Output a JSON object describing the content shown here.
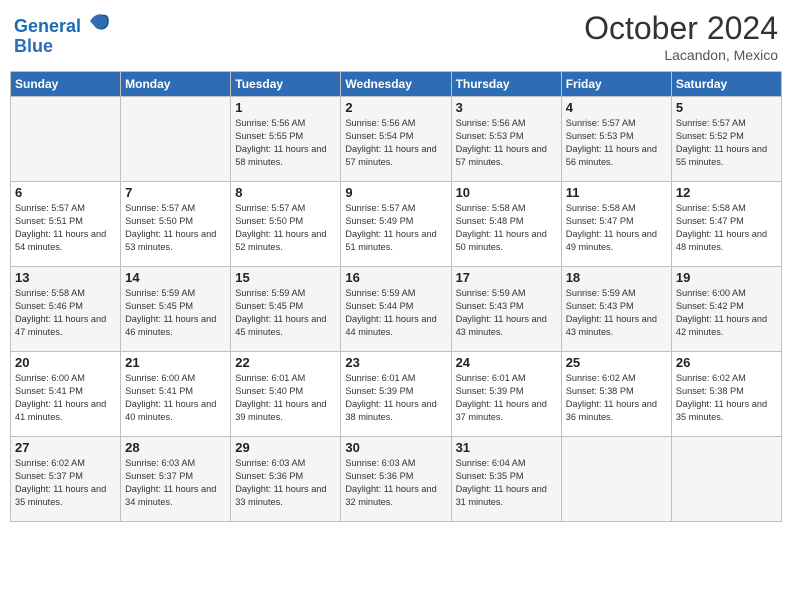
{
  "header": {
    "logo_line1": "General",
    "logo_line2": "Blue",
    "month": "October 2024",
    "location": "Lacandon, Mexico"
  },
  "weekdays": [
    "Sunday",
    "Monday",
    "Tuesday",
    "Wednesday",
    "Thursday",
    "Friday",
    "Saturday"
  ],
  "weeks": [
    [
      {
        "day": "",
        "info": ""
      },
      {
        "day": "",
        "info": ""
      },
      {
        "day": "1",
        "info": "Sunrise: 5:56 AM\nSunset: 5:55 PM\nDaylight: 11 hours and 58 minutes."
      },
      {
        "day": "2",
        "info": "Sunrise: 5:56 AM\nSunset: 5:54 PM\nDaylight: 11 hours and 57 minutes."
      },
      {
        "day": "3",
        "info": "Sunrise: 5:56 AM\nSunset: 5:53 PM\nDaylight: 11 hours and 57 minutes."
      },
      {
        "day": "4",
        "info": "Sunrise: 5:57 AM\nSunset: 5:53 PM\nDaylight: 11 hours and 56 minutes."
      },
      {
        "day": "5",
        "info": "Sunrise: 5:57 AM\nSunset: 5:52 PM\nDaylight: 11 hours and 55 minutes."
      }
    ],
    [
      {
        "day": "6",
        "info": "Sunrise: 5:57 AM\nSunset: 5:51 PM\nDaylight: 11 hours and 54 minutes."
      },
      {
        "day": "7",
        "info": "Sunrise: 5:57 AM\nSunset: 5:50 PM\nDaylight: 11 hours and 53 minutes."
      },
      {
        "day": "8",
        "info": "Sunrise: 5:57 AM\nSunset: 5:50 PM\nDaylight: 11 hours and 52 minutes."
      },
      {
        "day": "9",
        "info": "Sunrise: 5:57 AM\nSunset: 5:49 PM\nDaylight: 11 hours and 51 minutes."
      },
      {
        "day": "10",
        "info": "Sunrise: 5:58 AM\nSunset: 5:48 PM\nDaylight: 11 hours and 50 minutes."
      },
      {
        "day": "11",
        "info": "Sunrise: 5:58 AM\nSunset: 5:47 PM\nDaylight: 11 hours and 49 minutes."
      },
      {
        "day": "12",
        "info": "Sunrise: 5:58 AM\nSunset: 5:47 PM\nDaylight: 11 hours and 48 minutes."
      }
    ],
    [
      {
        "day": "13",
        "info": "Sunrise: 5:58 AM\nSunset: 5:46 PM\nDaylight: 11 hours and 47 minutes."
      },
      {
        "day": "14",
        "info": "Sunrise: 5:59 AM\nSunset: 5:45 PM\nDaylight: 11 hours and 46 minutes."
      },
      {
        "day": "15",
        "info": "Sunrise: 5:59 AM\nSunset: 5:45 PM\nDaylight: 11 hours and 45 minutes."
      },
      {
        "day": "16",
        "info": "Sunrise: 5:59 AM\nSunset: 5:44 PM\nDaylight: 11 hours and 44 minutes."
      },
      {
        "day": "17",
        "info": "Sunrise: 5:59 AM\nSunset: 5:43 PM\nDaylight: 11 hours and 43 minutes."
      },
      {
        "day": "18",
        "info": "Sunrise: 5:59 AM\nSunset: 5:43 PM\nDaylight: 11 hours and 43 minutes."
      },
      {
        "day": "19",
        "info": "Sunrise: 6:00 AM\nSunset: 5:42 PM\nDaylight: 11 hours and 42 minutes."
      }
    ],
    [
      {
        "day": "20",
        "info": "Sunrise: 6:00 AM\nSunset: 5:41 PM\nDaylight: 11 hours and 41 minutes."
      },
      {
        "day": "21",
        "info": "Sunrise: 6:00 AM\nSunset: 5:41 PM\nDaylight: 11 hours and 40 minutes."
      },
      {
        "day": "22",
        "info": "Sunrise: 6:01 AM\nSunset: 5:40 PM\nDaylight: 11 hours and 39 minutes."
      },
      {
        "day": "23",
        "info": "Sunrise: 6:01 AM\nSunset: 5:39 PM\nDaylight: 11 hours and 38 minutes."
      },
      {
        "day": "24",
        "info": "Sunrise: 6:01 AM\nSunset: 5:39 PM\nDaylight: 11 hours and 37 minutes."
      },
      {
        "day": "25",
        "info": "Sunrise: 6:02 AM\nSunset: 5:38 PM\nDaylight: 11 hours and 36 minutes."
      },
      {
        "day": "26",
        "info": "Sunrise: 6:02 AM\nSunset: 5:38 PM\nDaylight: 11 hours and 35 minutes."
      }
    ],
    [
      {
        "day": "27",
        "info": "Sunrise: 6:02 AM\nSunset: 5:37 PM\nDaylight: 11 hours and 35 minutes."
      },
      {
        "day": "28",
        "info": "Sunrise: 6:03 AM\nSunset: 5:37 PM\nDaylight: 11 hours and 34 minutes."
      },
      {
        "day": "29",
        "info": "Sunrise: 6:03 AM\nSunset: 5:36 PM\nDaylight: 11 hours and 33 minutes."
      },
      {
        "day": "30",
        "info": "Sunrise: 6:03 AM\nSunset: 5:36 PM\nDaylight: 11 hours and 32 minutes."
      },
      {
        "day": "31",
        "info": "Sunrise: 6:04 AM\nSunset: 5:35 PM\nDaylight: 11 hours and 31 minutes."
      },
      {
        "day": "",
        "info": ""
      },
      {
        "day": "",
        "info": ""
      }
    ]
  ]
}
